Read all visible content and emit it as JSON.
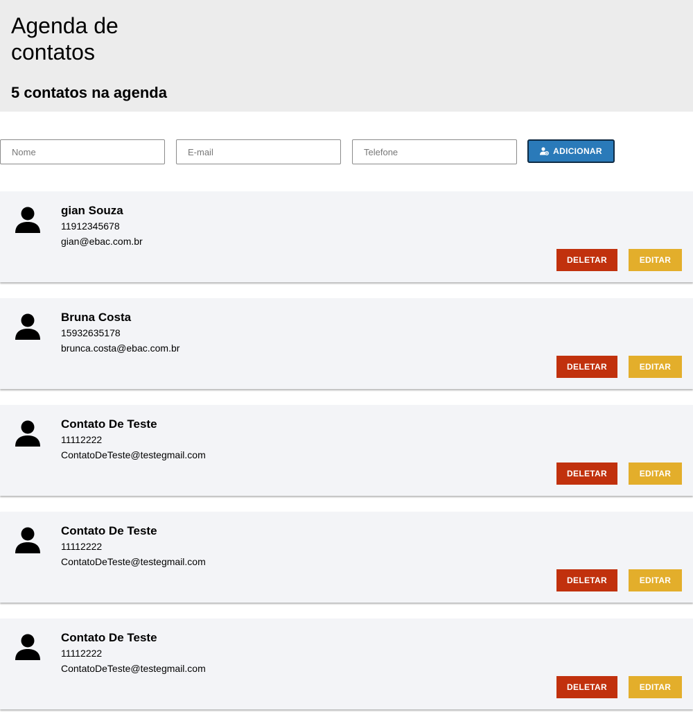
{
  "header": {
    "title": "Agenda de contatos",
    "count_text": "5 contatos na agenda"
  },
  "form": {
    "name_placeholder": "Nome",
    "email_placeholder": "E-mail",
    "phone_placeholder": "Telefone",
    "add_label": "ADICIONAR",
    "add_icon": "add-user-icon"
  },
  "contacts": [
    {
      "name": "gian Souza",
      "phone": "11912345678",
      "email": "gian@ebac.com.br"
    },
    {
      "name": "Bruna Costa",
      "phone": "15932635178",
      "email": "brunca.costa@ebac.com.br"
    },
    {
      "name": "Contato De Teste",
      "phone": "11112222",
      "email": "ContatoDeTeste@testegmail.com"
    },
    {
      "name": "Contato De Teste",
      "phone": "11112222",
      "email": "ContatoDeTeste@testegmail.com"
    },
    {
      "name": "Contato De Teste",
      "phone": "11112222",
      "email": "ContatoDeTeste@testegmail.com"
    }
  ],
  "buttons": {
    "delete_label": "DELETAR",
    "edit_label": "EDITAR"
  },
  "colors": {
    "header_bg": "#ececec",
    "card_bg": "#f3f4f7",
    "add_button": "#2a7ab9",
    "delete_button": "#c1310d",
    "edit_button": "#e3ae2b"
  }
}
